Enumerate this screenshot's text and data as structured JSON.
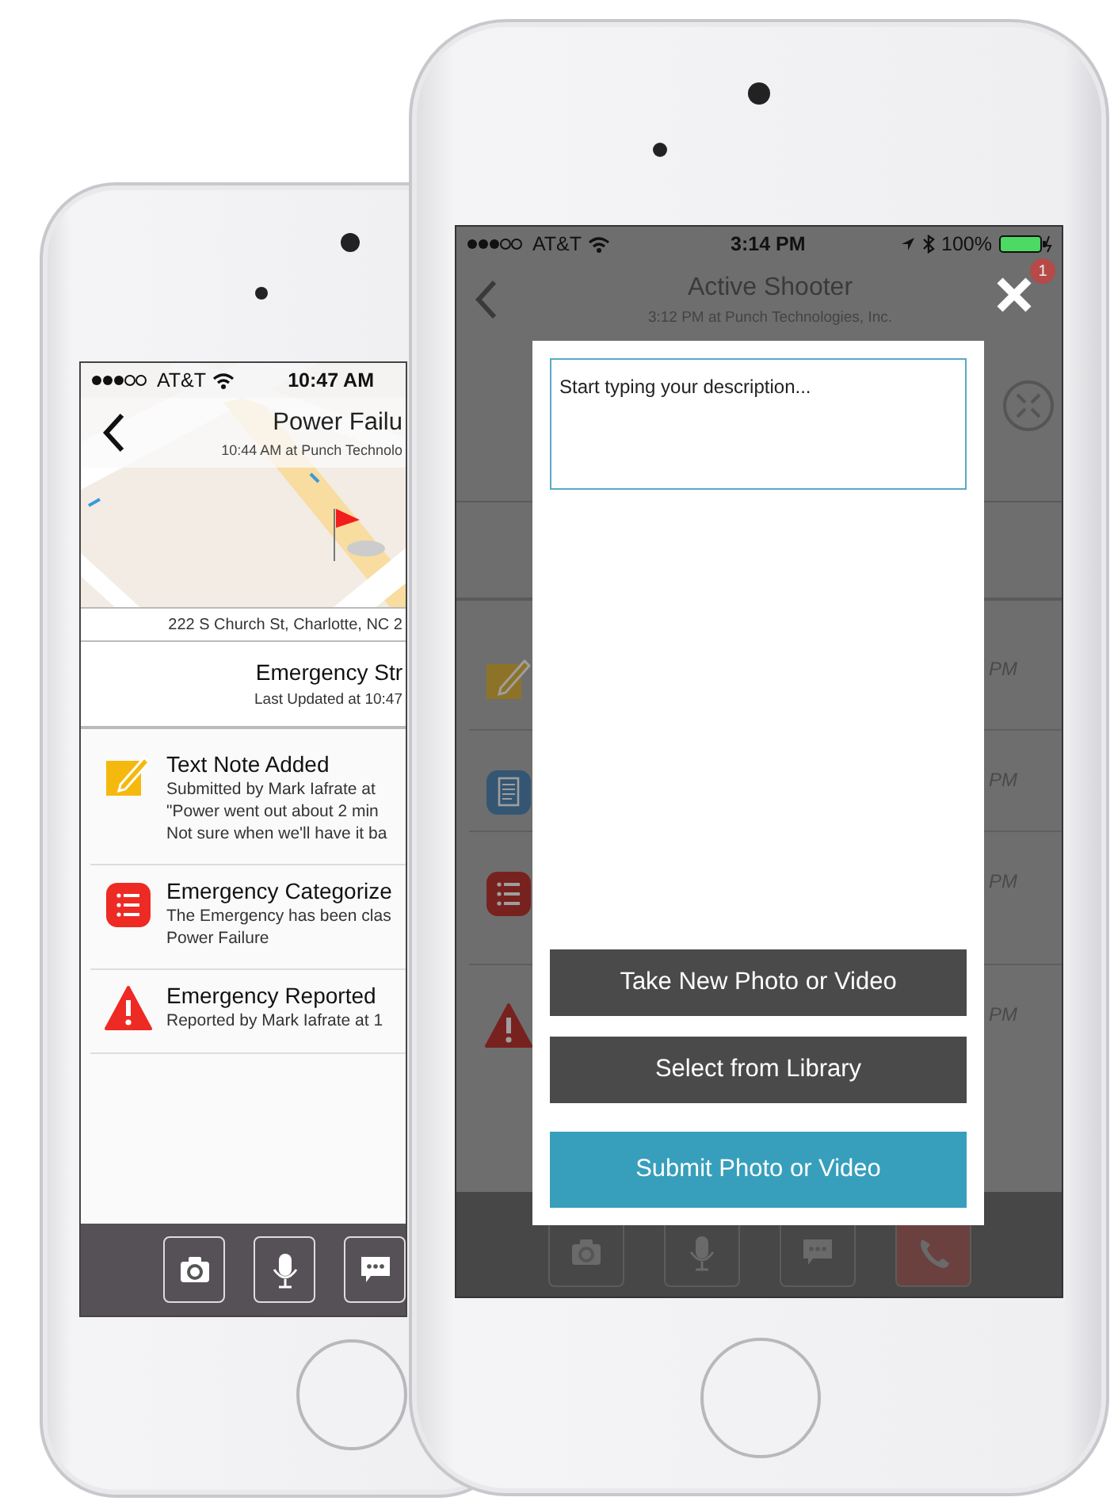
{
  "left_phone": {
    "status_bar": {
      "carrier": "AT&T",
      "time": "10:47 AM"
    },
    "header": {
      "title": "Power Failu",
      "subtitle": "10:44 AM at Punch Technolo"
    },
    "address": "222 S Church St, Charlotte, NC 2",
    "section": {
      "title": "Emergency Str",
      "subtitle": "Last Updated at 10:47"
    },
    "timeline": [
      {
        "kind": "note",
        "title": "Text Note Added",
        "lines": [
          "Submitted by Mark Iafrate at",
          "\"Power went out about 2 min",
          "Not sure when we'll have it ba"
        ]
      },
      {
        "kind": "category",
        "title": "Emergency Categorize",
        "lines": [
          "The Emergency has been clas",
          "Power Failure"
        ]
      },
      {
        "kind": "report",
        "title": "Emergency Reported",
        "lines": [
          "Reported by Mark Iafrate at 1"
        ]
      }
    ],
    "toolbar": [
      {
        "kind": "camera"
      },
      {
        "kind": "mic"
      },
      {
        "kind": "chat"
      }
    ]
  },
  "right_phone": {
    "status_bar": {
      "carrier": "AT&T",
      "time": "3:14 PM",
      "battery": "100%"
    },
    "header": {
      "title": "Active Shooter",
      "subtitle": "3:12 PM at Punch Technologies, Inc.",
      "badge": "1"
    },
    "timeline": [
      {
        "kind": "note",
        "time": "PM"
      },
      {
        "kind": "form",
        "time": "PM"
      },
      {
        "kind": "category",
        "time": "PM"
      },
      {
        "kind": "report",
        "time": "PM"
      }
    ],
    "modal": {
      "placeholder": "Start typing your description...",
      "buttons": [
        {
          "label": "Take New Photo or Video",
          "kind": "dark"
        },
        {
          "label": "Select from Library",
          "kind": "dark"
        },
        {
          "label": "Submit Photo or Video",
          "kind": "primary"
        }
      ]
    },
    "toolbar": [
      {
        "kind": "camera"
      },
      {
        "kind": "mic"
      },
      {
        "kind": "chat"
      },
      {
        "kind": "phone"
      }
    ]
  }
}
